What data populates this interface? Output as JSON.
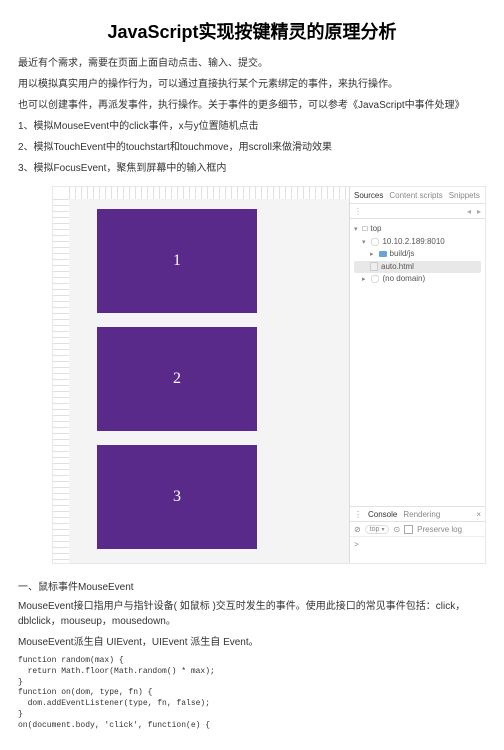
{
  "title": "JavaScript实现按键精灵的原理分析",
  "p1": "最近有个需求，需要在页面上面自动点击、输入、提交。",
  "p2": "用以模拟真实用户的操作行为，可以通过直接执行某个元素绑定的事件，来执行操作。",
  "p3": "也可以创建事件，再派发事件，执行操作。关于事件的更多细节，可以参考《JavaScript中事件处理》",
  "p4": "1、模拟MouseEvent中的click事件，x与y位置随机点击",
  "p5": "2、模拟TouchEvent中的touchstart和touchmove，用scroll来做滑动效果",
  "p6": "3、模拟FocusEvent，聚焦到屏幕中的输入框内",
  "boxes": [
    "1",
    "2",
    "3"
  ],
  "dev": {
    "tabs": {
      "a": "Sources",
      "b": "Content scripts",
      "c": "Snippets"
    },
    "toolbar_icons": {
      "menu": "⋮",
      "left": "◂",
      "right": "▸"
    },
    "tree": {
      "top": "top",
      "host": "10.10.2.189:8010",
      "folder": "build/js",
      "file": "auto.html",
      "nodomain": "(no domain)"
    },
    "consoleTabs": {
      "a": "Console",
      "b": "Rendering"
    },
    "consoleTools": {
      "clear": "⊘",
      "context": "top",
      "chev": "▾",
      "filter": "⊙",
      "preserve": "Preserve log"
    },
    "prompt": ">"
  },
  "sect1_head": "一、鼠标事件MouseEvent",
  "sect1_p1": "MouseEvent接口指用户与指针设备( 如鼠标 )交互时发生的事件。使用此接口的常见事件包括：click，dblclick，mouseup，mousedown。",
  "sect1_p2": "MouseEvent派生自 UIEvent，UIEvent 派生自 Event。",
  "code": "function random(max) {\n  return Math.floor(Math.random() * max);\n}\nfunction on(dom, type, fn) {\n  dom.addEventListener(type, fn, false);\n}\non(document.body, 'click', function(e) {"
}
